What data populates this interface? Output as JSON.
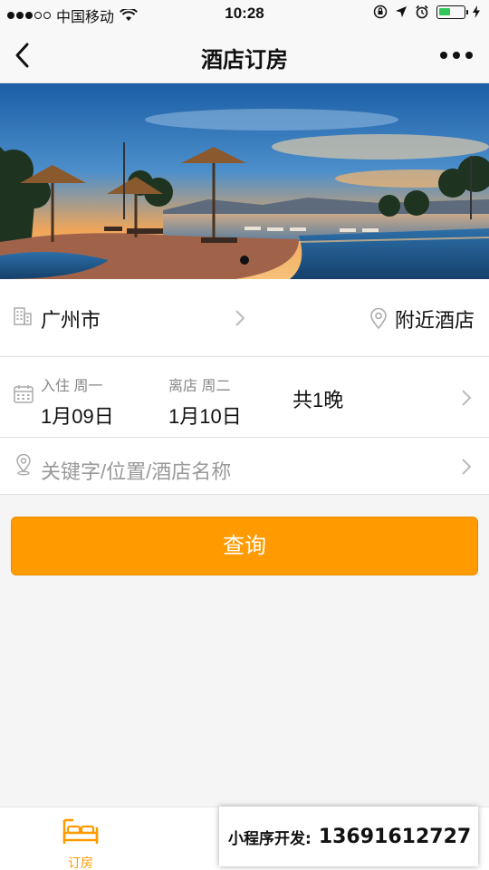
{
  "status_bar": {
    "carrier": "中国移动",
    "time": "10:28"
  },
  "nav": {
    "title": "酒店订房"
  },
  "city_row": {
    "city": "广州市",
    "nearby_label": "附近酒店"
  },
  "date_row": {
    "checkin_label": "入住 周一",
    "checkin_value": "1月09日",
    "checkout_label": "离店 周二",
    "checkout_value": "1月10日",
    "nights": "共1晚"
  },
  "search": {
    "placeholder": "关键字/位置/酒店名称"
  },
  "query_button": {
    "label": "查询"
  },
  "tabbar": {
    "tabs": [
      {
        "label": "订房",
        "icon": "bed-icon",
        "active": true
      }
    ]
  },
  "overlay": {
    "prefix": "小程序开发:",
    "phone": "13691612727"
  },
  "colors": {
    "accent": "#ff9b00",
    "battery": "#33c659"
  }
}
